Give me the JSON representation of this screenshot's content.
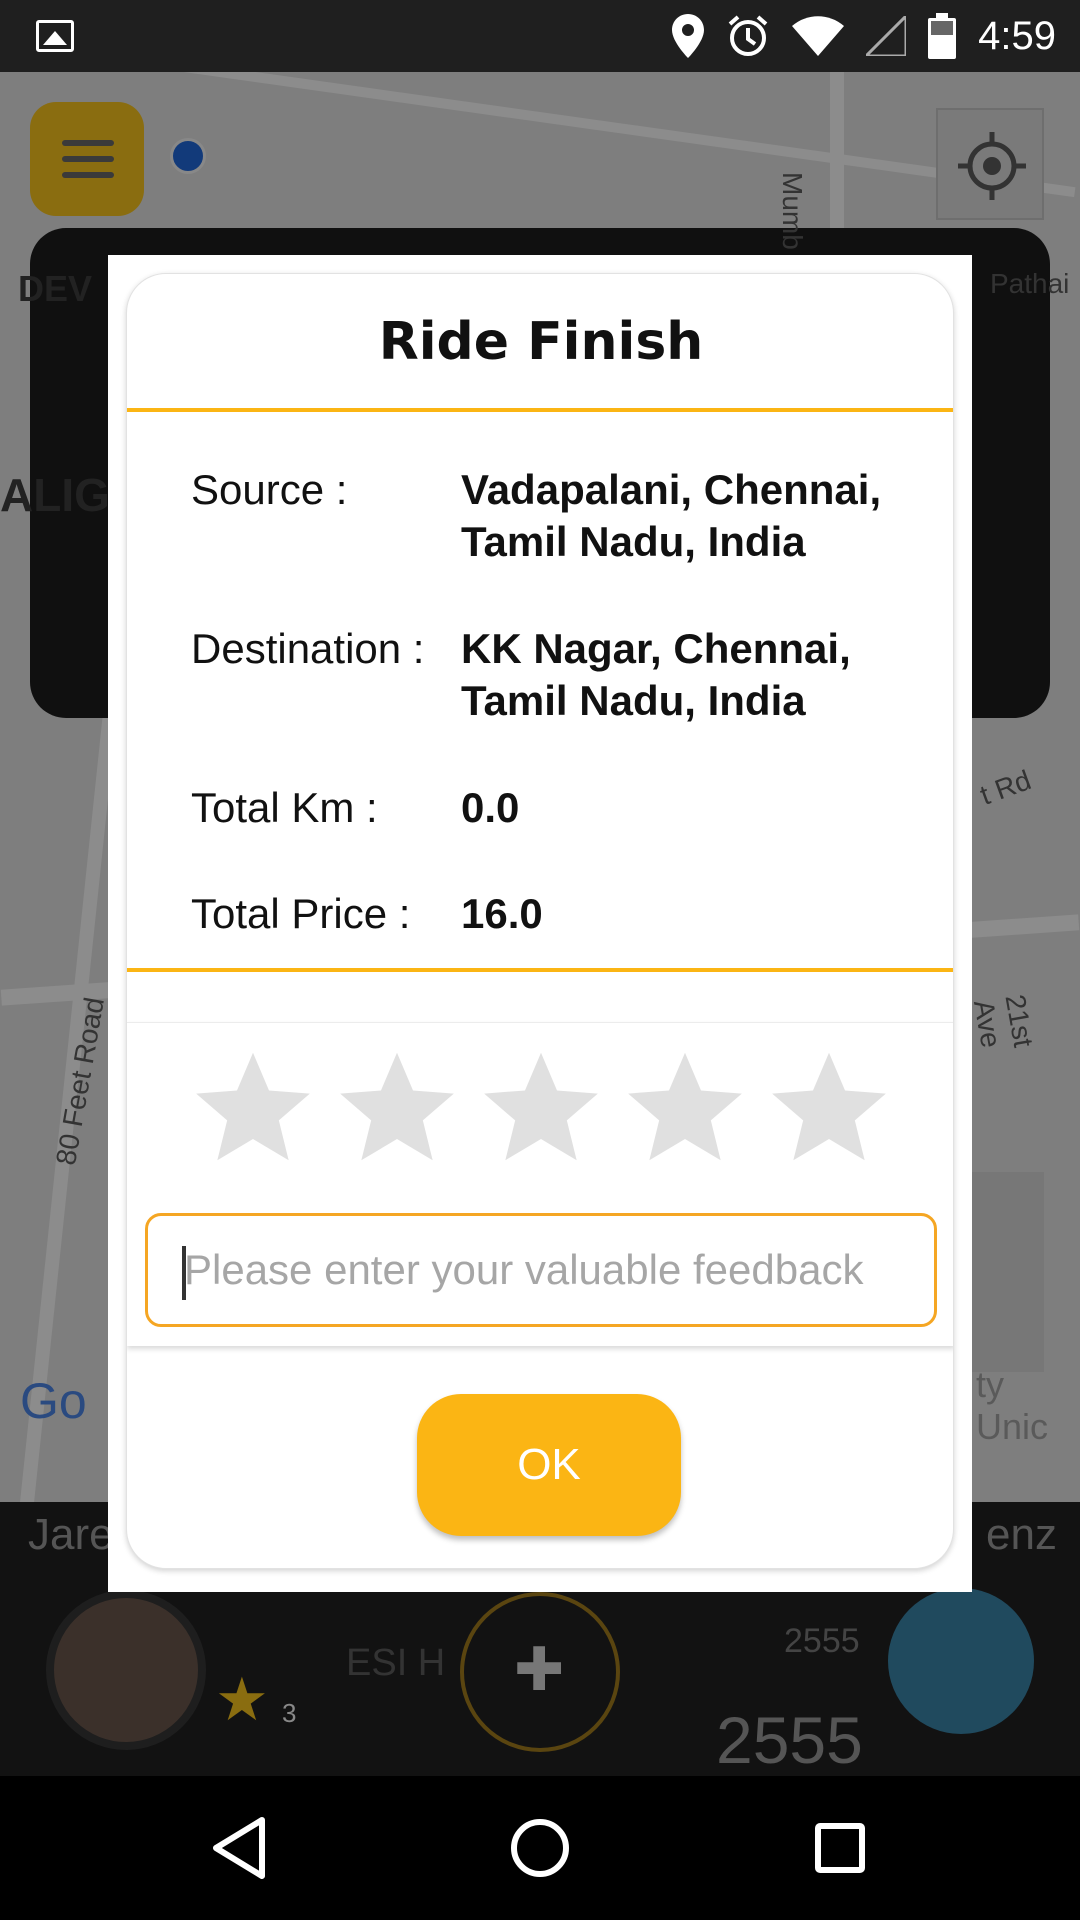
{
  "status_bar": {
    "time": "4:59",
    "icons": [
      "image-icon",
      "location-pin-icon",
      "alarm-icon",
      "wifi-icon",
      "signal-icon",
      "battery-icon"
    ]
  },
  "map": {
    "labels": [
      "Mumb",
      "Pathai",
      "80 Feet Road",
      "21st Ave",
      "t Rd",
      "DEV",
      "ALIG",
      "Go",
      "ty Unic"
    ]
  },
  "bottom_strip": {
    "driver_name_partial": "Jare",
    "car_name_partial": "enz",
    "rating": "3",
    "place_partial": "ESI H",
    "number_small": "2555",
    "number_large": "2555"
  },
  "dialog": {
    "title": "Ride Finish",
    "rows": [
      {
        "label": "Source :",
        "value": "Vadapalani, Chennai, Tamil Nadu, India"
      },
      {
        "label": "Destination :",
        "value": "KK Nagar, Chennai, Tamil Nadu, India"
      },
      {
        "label": "Total Km :",
        "value": "0.0"
      },
      {
        "label": "Total Price :",
        "value": "16.0"
      }
    ],
    "rating": {
      "selected": 0,
      "max": 5
    },
    "feedback": {
      "value": "",
      "placeholder": "Please enter your valuable feedback"
    },
    "ok_label": "OK"
  },
  "colors": {
    "accent": "#fbb514",
    "input_border": "#f5a623",
    "star_empty": "#e0e0e0"
  }
}
